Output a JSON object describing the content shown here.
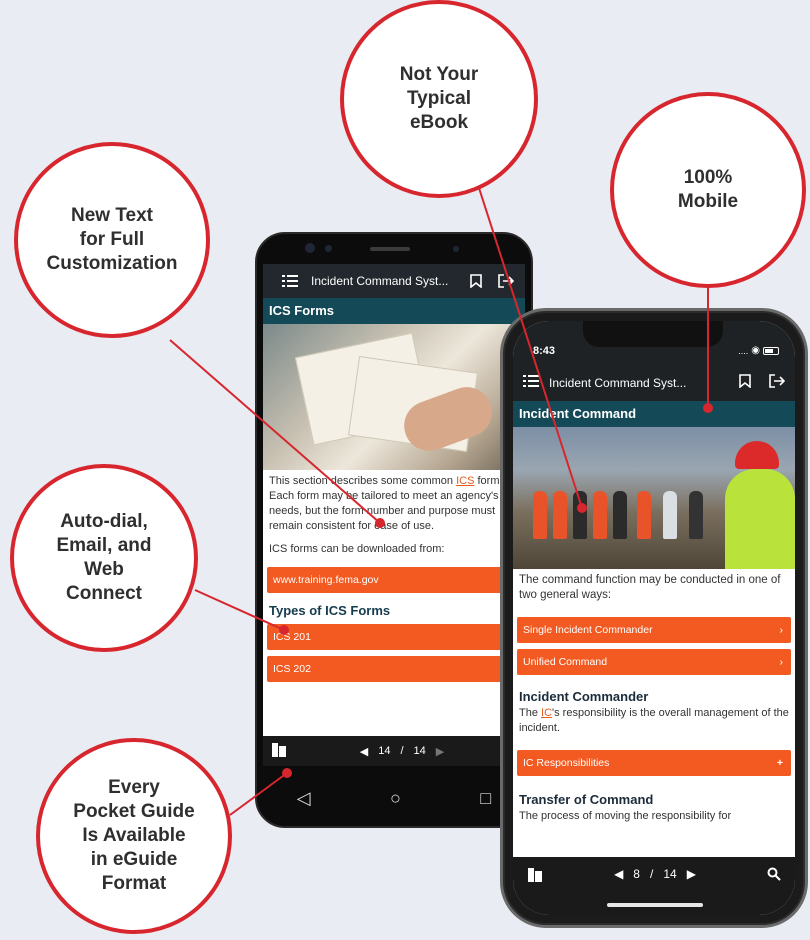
{
  "callouts": {
    "custom_text": "New Text\nfor Full\nCustomization",
    "ebook": "Not Your\nTypical\neBook",
    "mobile": "100%\nMobile",
    "autodial": "Auto-dial,\nEmail, and\nWeb\nConnect",
    "pocket_guide": "Every\nPocket Guide\nIs Available\nin eGuide\nFormat"
  },
  "colors": {
    "accent_red": "#d7262d",
    "orange": "#f25a22",
    "teal": "#144a57",
    "appbar": "#22282d"
  },
  "android": {
    "app_title": "Incident Command Syst...",
    "section_title": "ICS Forms",
    "para1_a": "This section describes some common ",
    "para1_link": "ICS",
    "para1_b": " forms. Each form may  be tailored to meet an agency's needs, but the form number and purpose must remain consistent for ease of use.",
    "para2": "ICS forms can be downloaded from:",
    "link_button": "www.training.fema.gov",
    "subheading": "Types of ICS Forms",
    "forms": [
      "ICS 201",
      "ICS 202"
    ],
    "page_current": "14",
    "page_sep": "/",
    "page_total": "14",
    "icons": [
      "menu-icon",
      "bookmark-icon",
      "exit-icon",
      "book-icon",
      "back-triangle-icon",
      "home-circle-icon",
      "recent-square-icon"
    ]
  },
  "iphone": {
    "time": "8:43",
    "app_title": "Incident Command Syst...",
    "section_title": "Incident Command",
    "para1": "The command function may be conducted in one of two general  ways:",
    "options": [
      "Single Incident Commander",
      "Unified Command"
    ],
    "subheading1": "Incident Commander",
    "para2_link": "IC",
    "para2_b": "'s responsibility is the overall management of the incident.",
    "para2_a": "The ",
    "expand_button": "IC Responsibilities",
    "subheading2": "Transfer of Command",
    "para3": "The process of moving the responsibility for",
    "page_current": "8",
    "page_sep": "/",
    "page_total": "14"
  }
}
